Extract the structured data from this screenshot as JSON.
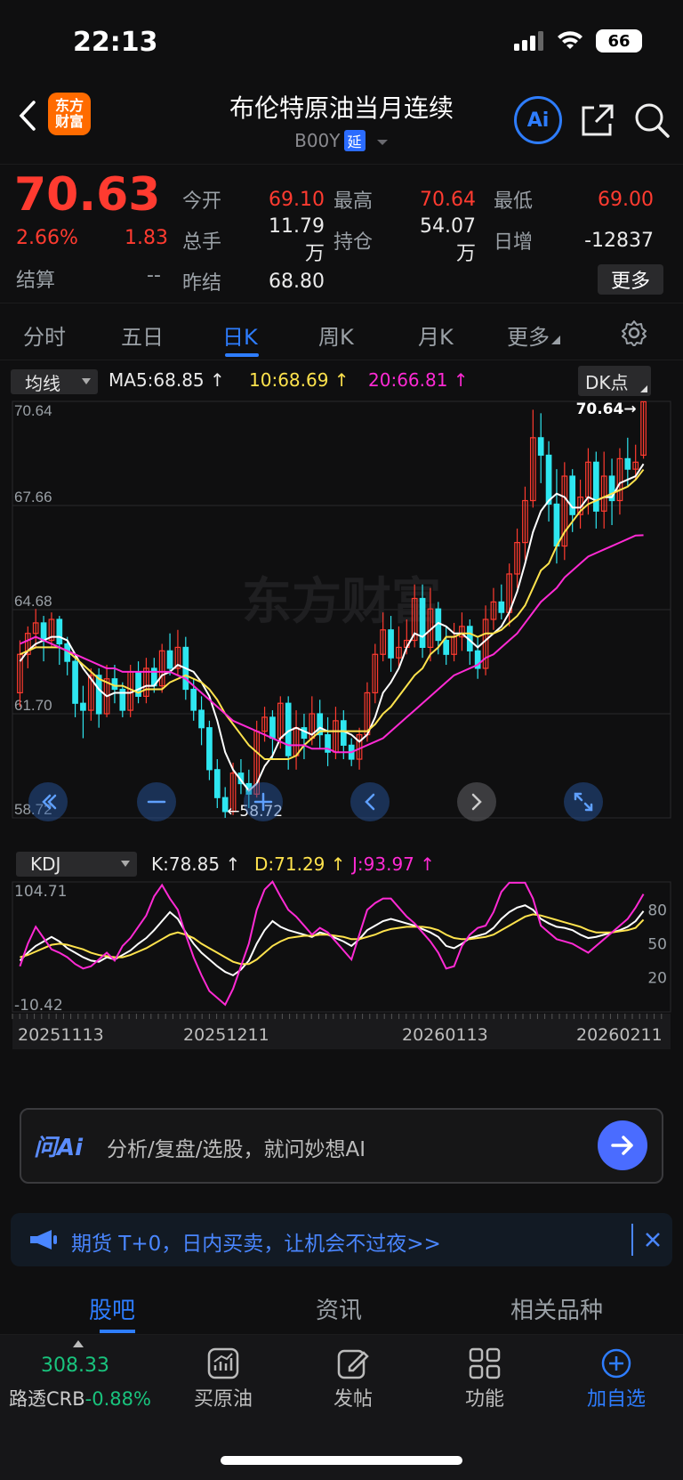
{
  "status": {
    "time": "22:13",
    "battery": "66"
  },
  "header": {
    "logo_line1": "东方",
    "logo_line2": "财富",
    "title": "布伦特原油当月连续",
    "code": "B00Y",
    "delay_tag": "延",
    "ai_label": "Ai"
  },
  "quote": {
    "price": "70.63",
    "pct": "2.66%",
    "change": "1.83",
    "settle_label": "结算",
    "settle_value": "--",
    "rows": [
      [
        {
          "label": "今开",
          "value": "69.10",
          "color": "#ff3b30"
        },
        {
          "label": "最高",
          "value": "70.64",
          "color": "#ff3b30"
        },
        {
          "label": "最低",
          "value": "69.00",
          "color": "#ff3b30"
        }
      ],
      [
        {
          "label": "总手",
          "value": "11.79万",
          "color": "#eaeaea"
        },
        {
          "label": "持仓",
          "value": "54.07万",
          "color": "#eaeaea"
        },
        {
          "label": "日增",
          "value": "-12837",
          "color": "#eaeaea"
        }
      ],
      [
        {
          "label": "昨结",
          "value": "68.80",
          "color": "#eaeaea"
        }
      ]
    ],
    "more_label": "更多"
  },
  "period_tabs": {
    "items": [
      "分时",
      "五日",
      "日K",
      "周K",
      "月K",
      "更多"
    ],
    "active": "日K"
  },
  "chart_bar": {
    "ma_select": "均线",
    "ma5": "MA5:68.85",
    "ma10": "10:68.69",
    "ma20": "20:66.81",
    "dk_label": "DK点"
  },
  "kdj_bar": {
    "select": "KDJ",
    "k": "K:78.85",
    "d": "D:71.29",
    "j": "J:93.97"
  },
  "chart_data": [
    {
      "type": "candlestick",
      "ylim": [
        58.72,
        70.64
      ],
      "y_ticks": [
        "70.64",
        "67.66",
        "64.68",
        "61.70",
        "58.72"
      ],
      "max_label": "70.64",
      "min_label": "58.72",
      "x_labels": [
        "20251113",
        "20251211",
        "20260113",
        "20260211"
      ],
      "candles": [
        [
          62.3,
          63.4,
          63.8,
          61.9
        ],
        [
          63.4,
          64.0,
          64.2,
          63.0
        ],
        [
          64.0,
          64.3,
          64.7,
          63.6
        ],
        [
          64.3,
          63.8,
          64.5,
          63.2
        ],
        [
          63.8,
          64.4,
          64.6,
          63.6
        ],
        [
          64.4,
          63.7,
          64.5,
          63.1
        ],
        [
          63.7,
          63.2,
          63.9,
          62.8
        ],
        [
          63.2,
          62.0,
          63.4,
          61.6
        ],
        [
          62.0,
          61.8,
          62.5,
          61.0
        ],
        [
          61.8,
          62.8,
          63.0,
          61.5
        ],
        [
          62.8,
          61.7,
          63.0,
          61.3
        ],
        [
          61.7,
          62.7,
          63.1,
          61.6
        ],
        [
          62.7,
          62.4,
          63.1,
          62.0
        ],
        [
          62.4,
          61.8,
          62.6,
          61.6
        ],
        [
          61.8,
          62.9,
          63.1,
          61.6
        ],
        [
          62.9,
          62.2,
          63.2,
          62.0
        ],
        [
          62.2,
          63.0,
          63.3,
          62.0
        ],
        [
          63.0,
          62.5,
          63.3,
          62.3
        ],
        [
          62.5,
          63.5,
          63.7,
          62.3
        ],
        [
          63.5,
          63.0,
          64.0,
          62.8
        ],
        [
          63.0,
          63.6,
          64.1,
          62.8
        ],
        [
          63.6,
          62.4,
          63.9,
          62.1
        ],
        [
          62.4,
          61.8,
          62.7,
          61.5
        ],
        [
          61.8,
          61.3,
          62.2,
          60.8
        ],
        [
          61.3,
          60.1,
          61.5,
          59.8
        ],
        [
          60.1,
          59.3,
          60.4,
          59.0
        ],
        [
          59.3,
          58.9,
          59.6,
          58.72
        ],
        [
          58.9,
          60.0,
          60.3,
          58.8
        ],
        [
          60.0,
          59.7,
          60.4,
          59.4
        ],
        [
          59.7,
          59.4,
          60.1,
          59.0
        ],
        [
          59.4,
          61.2,
          61.5,
          59.3
        ],
        [
          61.2,
          61.6,
          61.9,
          60.9
        ],
        [
          61.6,
          61.0,
          61.8,
          60.4
        ],
        [
          61.0,
          62.0,
          62.2,
          60.7
        ],
        [
          62.0,
          60.5,
          62.2,
          60.1
        ],
        [
          60.5,
          61.3,
          61.8,
          60.1
        ],
        [
          61.3,
          61.0,
          61.7,
          60.4
        ],
        [
          61.0,
          61.7,
          62.2,
          60.8
        ],
        [
          61.7,
          61.1,
          62.1,
          60.7
        ],
        [
          61.1,
          60.6,
          61.6,
          60.2
        ],
        [
          60.6,
          61.5,
          61.9,
          60.4
        ],
        [
          61.5,
          60.8,
          61.8,
          60.4
        ],
        [
          60.8,
          60.4,
          61.0,
          60.2
        ],
        [
          60.4,
          61.1,
          61.3,
          60.1
        ],
        [
          61.1,
          62.3,
          62.6,
          60.9
        ],
        [
          62.3,
          63.4,
          63.7,
          62.0
        ],
        [
          63.4,
          64.1,
          64.6,
          63.2
        ],
        [
          64.1,
          63.3,
          64.5,
          62.9
        ],
        [
          63.3,
          63.6,
          64.2,
          63.0
        ],
        [
          63.6,
          63.8,
          64.4,
          63.4
        ],
        [
          63.8,
          65.0,
          65.4,
          63.6
        ],
        [
          65.0,
          63.6,
          65.4,
          63.3
        ],
        [
          63.6,
          64.7,
          65.3,
          63.2
        ],
        [
          64.7,
          63.8,
          64.9,
          63.4
        ],
        [
          63.8,
          63.4,
          64.2,
          63.1
        ],
        [
          63.4,
          63.9,
          64.3,
          63.2
        ],
        [
          63.9,
          64.2,
          64.6,
          63.5
        ],
        [
          64.2,
          63.5,
          64.4,
          63.1
        ],
        [
          63.5,
          63.0,
          63.9,
          62.7
        ],
        [
          63.0,
          64.4,
          64.8,
          62.8
        ],
        [
          64.4,
          64.9,
          65.3,
          64.1
        ],
        [
          64.9,
          64.6,
          65.4,
          64.4
        ],
        [
          64.6,
          65.7,
          66.0,
          64.2
        ],
        [
          65.7,
          66.6,
          67.0,
          65.3
        ],
        [
          66.6,
          67.8,
          68.2,
          66.1
        ],
        [
          67.8,
          69.6,
          70.4,
          67.6
        ],
        [
          69.6,
          69.1,
          70.3,
          68.3
        ],
        [
          69.1,
          67.7,
          69.5,
          67.2
        ],
        [
          67.7,
          66.5,
          68.7,
          66.0
        ],
        [
          66.5,
          68.5,
          68.9,
          66.1
        ],
        [
          68.5,
          67.4,
          68.7,
          66.9
        ],
        [
          67.4,
          67.9,
          68.4,
          67.0
        ],
        [
          67.9,
          68.9,
          69.3,
          67.4
        ],
        [
          68.9,
          67.5,
          69.2,
          67.0
        ],
        [
          67.5,
          68.5,
          69.2,
          67.0
        ],
        [
          68.5,
          67.8,
          69.0,
          67.1
        ],
        [
          67.8,
          69.0,
          69.3,
          67.4
        ],
        [
          69.0,
          68.7,
          69.6,
          68.2
        ],
        [
          68.7,
          68.9,
          69.4,
          68.4
        ],
        [
          69.1,
          70.63,
          70.64,
          69.0
        ]
      ],
      "series": [
        {
          "name": "MA5",
          "color": "#ffffff",
          "values": [
            63.2,
            63.5,
            63.7,
            63.8,
            63.9,
            63.9,
            63.8,
            63.4,
            63.0,
            62.7,
            62.4,
            62.2,
            62.3,
            62.3,
            62.3,
            62.4,
            62.5,
            62.5,
            62.8,
            62.9,
            63.1,
            63.0,
            62.9,
            62.6,
            62.2,
            61.5,
            60.6,
            60.1,
            59.8,
            59.5,
            59.7,
            60.2,
            60.5,
            61.0,
            61.2,
            61.3,
            61.2,
            61.1,
            61.3,
            61.2,
            61.2,
            61.2,
            61.1,
            60.9,
            61.1,
            61.6,
            62.3,
            62.6,
            63.0,
            63.6,
            64.0,
            63.9,
            64.1,
            64.3,
            64.2,
            64.0,
            64.0,
            63.8,
            63.6,
            63.8,
            64.0,
            64.2,
            64.6,
            65.2,
            66.0,
            66.9,
            67.5,
            67.8,
            68.0,
            67.9,
            67.6,
            67.6,
            67.9,
            67.8,
            67.9,
            67.9,
            68.3,
            68.4,
            68.5,
            68.85
          ]
        },
        {
          "name": "MA10",
          "color": "#ffe34d",
          "values": [
            63.4,
            63.5,
            63.6,
            63.6,
            63.6,
            63.6,
            63.5,
            63.3,
            63.1,
            62.9,
            62.7,
            62.6,
            62.5,
            62.5,
            62.4,
            62.3,
            62.4,
            62.4,
            62.4,
            62.6,
            62.7,
            62.8,
            62.7,
            62.6,
            62.4,
            62.1,
            61.7,
            61.4,
            61.1,
            60.8,
            60.6,
            60.4,
            60.4,
            60.4,
            60.4,
            60.5,
            60.8,
            61.0,
            61.2,
            61.2,
            61.2,
            61.2,
            61.2,
            61.2,
            61.2,
            61.4,
            61.7,
            61.9,
            62.2,
            62.5,
            62.8,
            63.0,
            63.4,
            63.6,
            63.9,
            63.9,
            64.0,
            64.0,
            63.9,
            64.0,
            64.0,
            64.1,
            64.3,
            64.5,
            64.8,
            65.3,
            65.8,
            66.0,
            66.5,
            66.9,
            67.2,
            67.5,
            67.7,
            67.8,
            67.9,
            68.0,
            68.1,
            68.2,
            68.4,
            68.69
          ]
        },
        {
          "name": "MA20",
          "color": "#ff2ad4",
          "values": [
            63.7,
            63.8,
            63.9,
            63.8,
            63.7,
            63.6,
            63.5,
            63.4,
            63.3,
            63.2,
            63.1,
            63.0,
            63.0,
            62.9,
            62.9,
            62.9,
            62.9,
            62.9,
            62.9,
            62.9,
            62.8,
            62.7,
            62.5,
            62.3,
            62.1,
            61.9,
            61.7,
            61.5,
            61.4,
            61.3,
            61.2,
            61.1,
            61.0,
            60.9,
            60.8,
            60.8,
            60.8,
            60.7,
            60.7,
            60.7,
            60.6,
            60.6,
            60.6,
            60.7,
            60.8,
            60.9,
            61.0,
            61.2,
            61.4,
            61.6,
            61.8,
            62.0,
            62.2,
            62.4,
            62.6,
            62.8,
            62.9,
            63.0,
            63.1,
            63.3,
            63.4,
            63.6,
            63.8,
            64.0,
            64.3,
            64.6,
            64.9,
            65.1,
            65.3,
            65.6,
            65.8,
            66.0,
            66.2,
            66.3,
            66.4,
            66.5,
            66.6,
            66.7,
            66.8,
            66.81
          ]
        }
      ]
    },
    {
      "type": "line",
      "title": "KDJ",
      "ylim": [
        -10.42,
        104.71
      ],
      "y_ticks": [
        "104.71",
        "-10.42"
      ],
      "right_ticks": [
        "80",
        "50",
        "20"
      ],
      "series": [
        {
          "name": "K",
          "color": "#ffffff",
          "values": [
            35,
            42,
            48,
            52,
            56,
            52,
            46,
            42,
            38,
            35,
            34,
            38,
            36,
            40,
            44,
            50,
            55,
            62,
            70,
            78,
            72,
            60,
            50,
            42,
            36,
            30,
            25,
            22,
            27,
            35,
            50,
            62,
            70,
            65,
            62,
            60,
            58,
            56,
            60,
            58,
            55,
            52,
            48,
            54,
            62,
            66,
            70,
            72,
            70,
            68,
            66,
            63,
            60,
            56,
            48,
            46,
            50,
            55,
            57,
            59,
            64,
            72,
            78,
            82,
            84,
            80,
            72,
            68,
            65,
            64,
            62,
            58,
            55,
            56,
            58,
            60,
            62,
            65,
            70,
            78.85
          ]
        },
        {
          "name": "D",
          "color": "#ffe34d",
          "values": [
            38,
            40,
            43,
            46,
            49,
            50,
            49,
            47,
            45,
            42,
            40,
            39,
            38,
            38,
            40,
            43,
            46,
            50,
            54,
            58,
            60,
            58,
            55,
            50,
            46,
            42,
            38,
            34,
            32,
            32,
            36,
            42,
            48,
            52,
            55,
            56,
            57,
            57,
            58,
            58,
            57,
            56,
            54,
            54,
            56,
            58,
            61,
            63,
            64,
            65,
            65,
            65,
            64,
            62,
            58,
            55,
            54,
            54,
            55,
            56,
            58,
            62,
            66,
            70,
            74,
            76,
            75,
            73,
            71,
            69,
            67,
            65,
            62,
            60,
            60,
            60,
            61,
            62,
            64,
            71.29
          ]
        },
        {
          "name": "J",
          "color": "#ff2ad4",
          "values": [
            30,
            50,
            65,
            55,
            45,
            42,
            38,
            32,
            28,
            30,
            36,
            42,
            35,
            48,
            55,
            65,
            75,
            92,
            102,
            90,
            80,
            58,
            38,
            22,
            8,
            2,
            -4,
            10,
            30,
            50,
            80,
            98,
            105,
            92,
            80,
            74,
            66,
            58,
            64,
            60,
            52,
            44,
            36,
            58,
            80,
            86,
            90,
            90,
            82,
            74,
            68,
            60,
            52,
            42,
            28,
            30,
            48,
            58,
            64,
            66,
            78,
            96,
            104,
            104,
            104,
            90,
            66,
            60,
            54,
            52,
            50,
            46,
            42,
            48,
            54,
            60,
            66,
            72,
            82,
            93.97
          ]
        }
      ]
    }
  ],
  "chart_nav_icons": [
    "double-left-icon",
    "zoom-out-icon",
    "zoom-in-icon",
    "prev-icon",
    "next-icon",
    "fullscreen-icon"
  ],
  "ai_input": {
    "label": "问Ai",
    "placeholder": "分析/复盘/选股，就问妙想AI"
  },
  "notice": {
    "text": "期货 T+0，日内买卖，让机会不过夜>>"
  },
  "content_tabs": {
    "items": [
      "股吧",
      "资讯",
      "相关品种"
    ],
    "active": "股吧"
  },
  "dock": {
    "ticker_value": "308.33",
    "ticker_label": "路透CRB",
    "ticker_change": "-0.88%",
    "items": [
      {
        "label": "买原油",
        "icon": "chart-trade-icon"
      },
      {
        "label": "发帖",
        "icon": "edit-icon"
      },
      {
        "label": "功能",
        "icon": "grid-icon"
      },
      {
        "label": "加自选",
        "icon": "add-favorite-icon"
      }
    ]
  },
  "colors": {
    "up": "#ff3b30",
    "down": "#19c37d",
    "accent": "#2e7dff",
    "bg": "#0f0f10"
  }
}
